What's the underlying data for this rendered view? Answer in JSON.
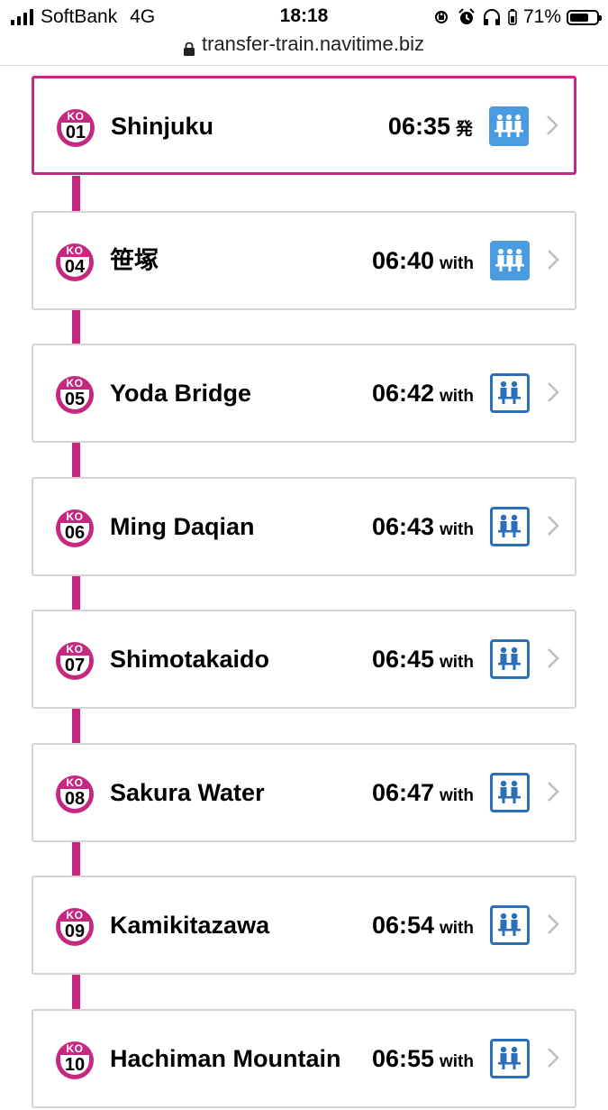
{
  "status_bar": {
    "carrier": "SoftBank",
    "network": "4G",
    "time": "18:18",
    "battery_percent": "71%",
    "battery_level": 0.71,
    "icons": [
      "orientation-lock-icon",
      "alarm-icon",
      "headphones-icon",
      "battery-icon"
    ]
  },
  "url_bar": {
    "url": "transfer-train.navitime.biz",
    "icon": "lock-icon"
  },
  "colors": {
    "line": "#c6287f",
    "car_border": "#2a6fb7",
    "car_crowded_fill": "#4a9be0",
    "card_border": "#d4d4d4"
  },
  "stations": [
    {
      "line_code": "KO",
      "number": "01",
      "name": "Shinjuku",
      "time": "06:35",
      "suffix": "発",
      "current": true,
      "crowding_icon": "crowded-car-icon"
    },
    {
      "line_code": "KO",
      "number": "04",
      "name": "笹塚",
      "time": "06:40",
      "suffix": "with",
      "current": false,
      "crowding_icon": "crowded-car-icon"
    },
    {
      "line_code": "KO",
      "number": "05",
      "name": "Yoda Bridge",
      "time": "06:42",
      "suffix": "with",
      "current": false,
      "crowding_icon": "seated-car-icon"
    },
    {
      "line_code": "KO",
      "number": "06",
      "name": "Ming Daqian",
      "time": "06:43",
      "suffix": "with",
      "current": false,
      "crowding_icon": "seated-car-icon"
    },
    {
      "line_code": "KO",
      "number": "07",
      "name": "Shimotakaido",
      "time": "06:45",
      "suffix": "with",
      "current": false,
      "crowding_icon": "seated-car-icon"
    },
    {
      "line_code": "KO",
      "number": "08",
      "name": "Sakura Water",
      "time": "06:47",
      "suffix": "with",
      "current": false,
      "crowding_icon": "seated-car-icon"
    },
    {
      "line_code": "KO",
      "number": "09",
      "name": "Kamikitazawa",
      "time": "06:54",
      "suffix": "with",
      "current": false,
      "crowding_icon": "seated-car-icon"
    },
    {
      "line_code": "KO",
      "number": "10",
      "name": "Hachiman Mountain",
      "time": "06:55",
      "suffix": "with",
      "current": false,
      "crowding_icon": "seated-car-icon"
    }
  ]
}
